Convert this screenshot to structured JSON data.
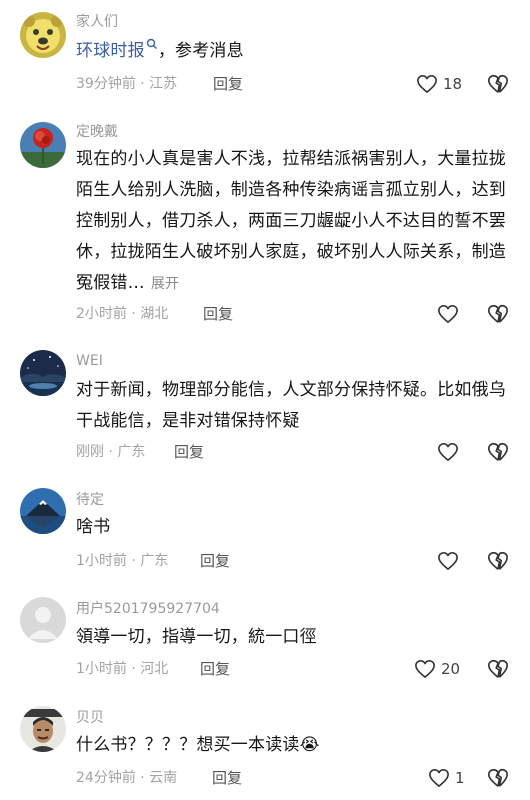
{
  "comments": [
    {
      "username": "家人们",
      "link_text": "环球时报",
      "text_after_link": "，参考消息",
      "time_location": "39分钟前 · 江苏",
      "reply": "回复",
      "likes": "18"
    },
    {
      "username": "定晚戴",
      "text": "现在的小人真是害人不浅，拉帮结派祸害别人，大量拉拢陌生人给别人洗脑，制造各种传染病谣言孤立别人，达到控制别人，借刀杀人，两面三刀龌龊小人不达目的誓不罢休，拉拢陌生人破坏别人家庭，破坏别人人际关系，制造冤假错…",
      "expand": "展开",
      "time_location": "2小时前 · 湖北",
      "reply": "回复",
      "likes": ""
    },
    {
      "username": "WEI",
      "text": "对于新闻，物理部分能信，人文部分保持怀疑。比如俄乌干战能信，是非对错保持怀疑",
      "time_location": "刚刚 · 广东",
      "reply": "回复",
      "likes": ""
    },
    {
      "username": "待定",
      "text": "啥书",
      "time_location": "1小时前 · 广东",
      "reply": "回复",
      "likes": ""
    },
    {
      "username": "用户5201795927704",
      "text": "領導一切，指導一切，統一口徑",
      "time_location": "1小时前 · 河北",
      "reply": "回复",
      "likes": "20"
    },
    {
      "username": "贝贝",
      "text": "什么书？？？？想买一本读读",
      "emoji": "😭",
      "time_location": "24分钟前 · 云南",
      "reply": "回复",
      "likes": "1"
    }
  ]
}
